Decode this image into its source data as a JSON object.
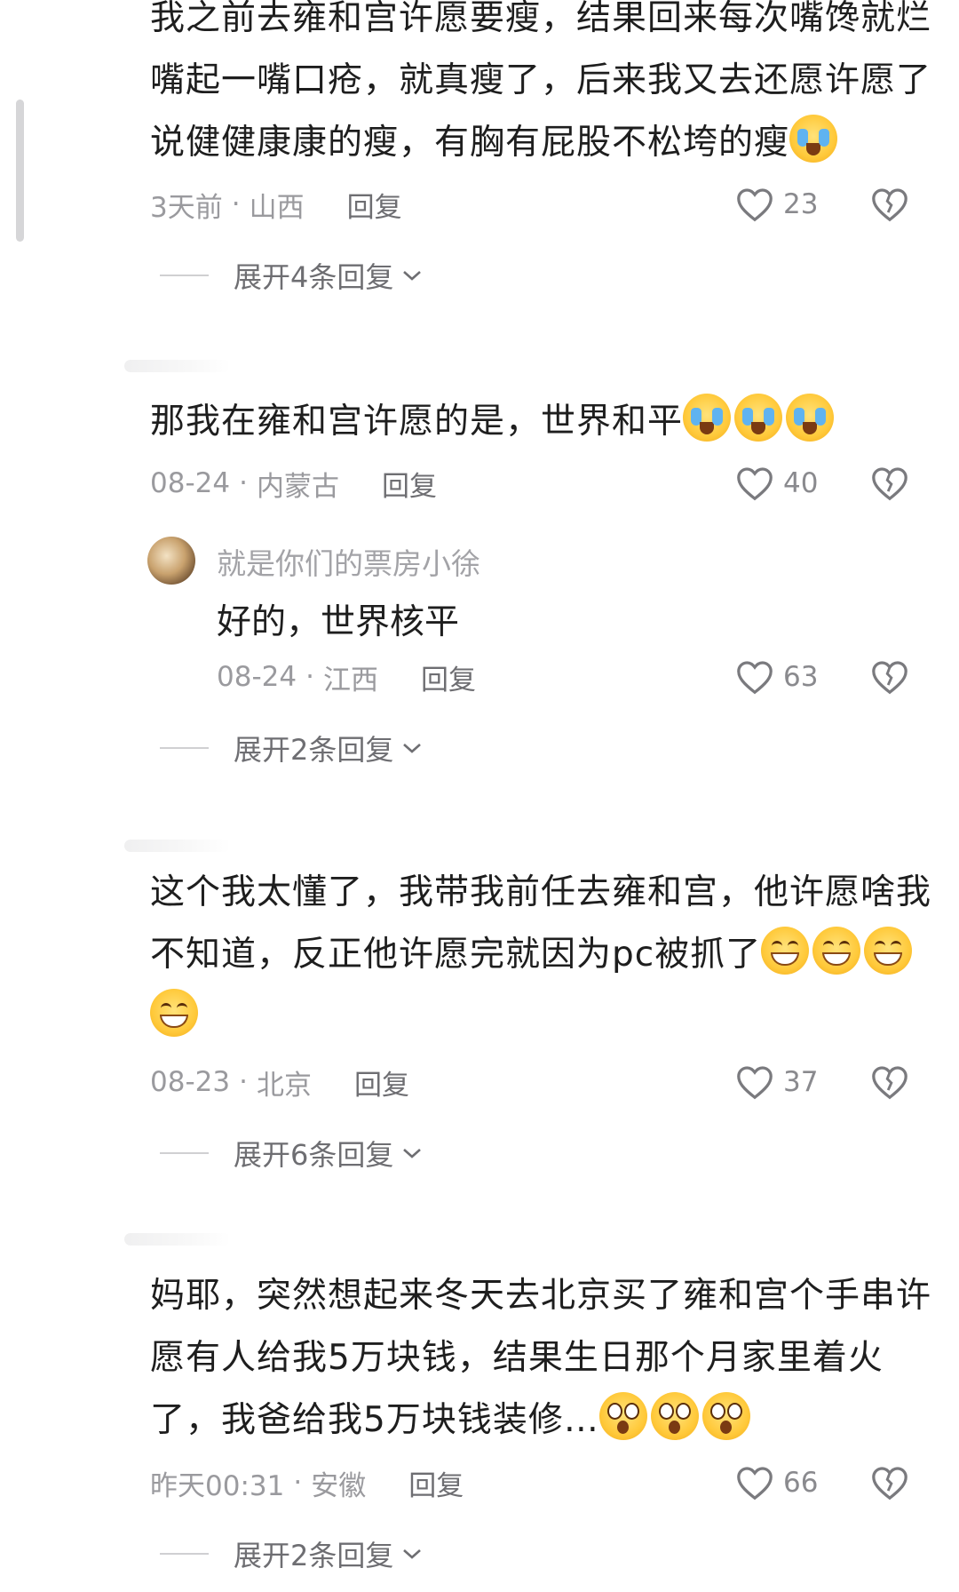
{
  "comments": [
    {
      "text": "我之前去雍和宫许愿要瘦，结果回来每次嘴馋就烂嘴起一嘴口疮，就真瘦了，后来我又去还愿许愿了说健健康康的瘦，有胸有屁股不松垮的瘦",
      "time": "3天前",
      "location": "山西",
      "reply_label": "回复",
      "likes": "23",
      "expand_label": "展开4条回复"
    },
    {
      "text": "那我在雍和宫许愿的是，世界和平",
      "time": "08-24",
      "location": "内蒙古",
      "reply_label": "回复",
      "likes": "40",
      "sub": {
        "name": "就是你们的票房小徐",
        "text": "好的，世界核平",
        "time": "08-24",
        "location": "江西",
        "reply_label": "回复",
        "likes": "63"
      },
      "expand_label": "展开2条回复"
    },
    {
      "text": "这个我太懂了，我带我前任去雍和宫，他许愿啥我不知道，反正他许愿完就因为pc被抓了",
      "time": "08-23",
      "location": "北京",
      "reply_label": "回复",
      "likes": "37",
      "expand_label": "展开6条回复"
    },
    {
      "text": "妈耶，突然想起来冬天去北京买了雍和宫个手串许愿有人给我5万块钱，结果生日那个月家里着火了，我爸给我5万块钱装修…",
      "time": "昨天00:31",
      "location": "安徽",
      "reply_label": "回复",
      "likes": "66",
      "expand_label": "展开2条回复"
    }
  ],
  "separator": "·",
  "icons": {
    "like": "heart-outline-icon",
    "dislike": "broken-heart-icon",
    "expand": "chevron-down-icon"
  },
  "colors": {
    "text": "#1e1e1e",
    "meta": "#9a9a9e",
    "secondary": "#6e6e72",
    "emoji_yellow": "#ffc93a",
    "tear_blue": "#5fb3f0"
  }
}
